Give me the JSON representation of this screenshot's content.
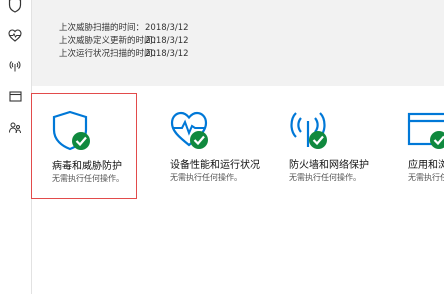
{
  "colors": {
    "accent": "#0078d7",
    "check": "#10893e",
    "selection": "#e24b4b"
  },
  "sidebar": {
    "items": [
      {
        "icon": "shield-icon"
      },
      {
        "icon": "heart-icon"
      },
      {
        "icon": "wifi-antenna-icon"
      },
      {
        "icon": "browser-window-icon"
      },
      {
        "icon": "family-icon"
      }
    ]
  },
  "scan": {
    "rows": [
      {
        "label": "上次威胁扫描的时间：",
        "value": "2018/3/12"
      },
      {
        "label": "上次威胁定义更新的时间：",
        "value": "2018/3/12"
      },
      {
        "label": "上次运行状况扫描的时间：",
        "value": "2018/3/12"
      }
    ]
  },
  "tiles": [
    {
      "icon": "shield-check-icon",
      "title": "病毒和威胁防护",
      "subtitle": "无需执行任何操作。"
    },
    {
      "icon": "heart-check-icon",
      "title": "设备性能和运行状况",
      "subtitle": "无需执行任何操作。"
    },
    {
      "icon": "antenna-check-icon",
      "title": "防火墙和网络保护",
      "subtitle": "无需执行任何操作。"
    },
    {
      "icon": "window-check-icon",
      "title": "应用和浏",
      "subtitle": "无需执行任"
    }
  ]
}
